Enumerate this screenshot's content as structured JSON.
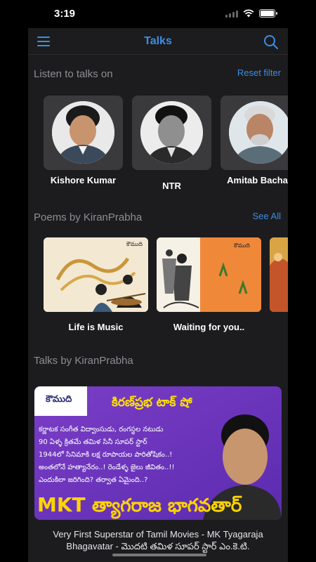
{
  "status": {
    "time": "3:19"
  },
  "navbar": {
    "title": "Talks"
  },
  "listen_section": {
    "title": "Listen to talks on",
    "action": "Reset filter"
  },
  "talkers": [
    {
      "name": "Kishore Kumar"
    },
    {
      "name": "NTR"
    },
    {
      "name": "Amitab Bachan"
    }
  ],
  "poems_section": {
    "title": "Poems by KiranPrabha",
    "action": "See All"
  },
  "poems": [
    {
      "title": "Life is Music",
      "masthead": "కౌముది"
    },
    {
      "title": "Waiting for you..",
      "masthead": "కౌముది"
    }
  ],
  "talks_section": {
    "title": "Talks by KiranPrabha"
  },
  "featured_talk": {
    "masthead": "కౌముది",
    "show_title": "కిరణ్‌ప్రభ టాక్ షో",
    "banner_lines": [
      "కర్ణాటక సంగీత విద్వాంసుడు, రంగస్థల నటుడు",
      "90 ఏళ్ళ క్రితమే తమిళ సినీ సూపర్ స్టార్",
      "1944లో సినిమాకి లక్ష రూపాయల పారితోషికం..!",
      "అంతలోనే హత్యానేరం..! రెండేళ్ళ జైలు జీవితం..!!",
      "ఎందుకిలా జరిగింది? తర్వాత ఏమైంది..?"
    ],
    "banner_name_en": "MKT",
    "banner_name_te": "త్యాగరాజ భాగవతార్",
    "caption": "Very First Superstar of Tamil Movies - MK Tyagaraja Bhagavatar - మొదటి తమిళ సూపర్ స్టార్ ఎం.కె.టి."
  },
  "colors": {
    "accent": "#3a8ee6",
    "background": "#1c1c1e",
    "card": "#3a3a3c"
  }
}
